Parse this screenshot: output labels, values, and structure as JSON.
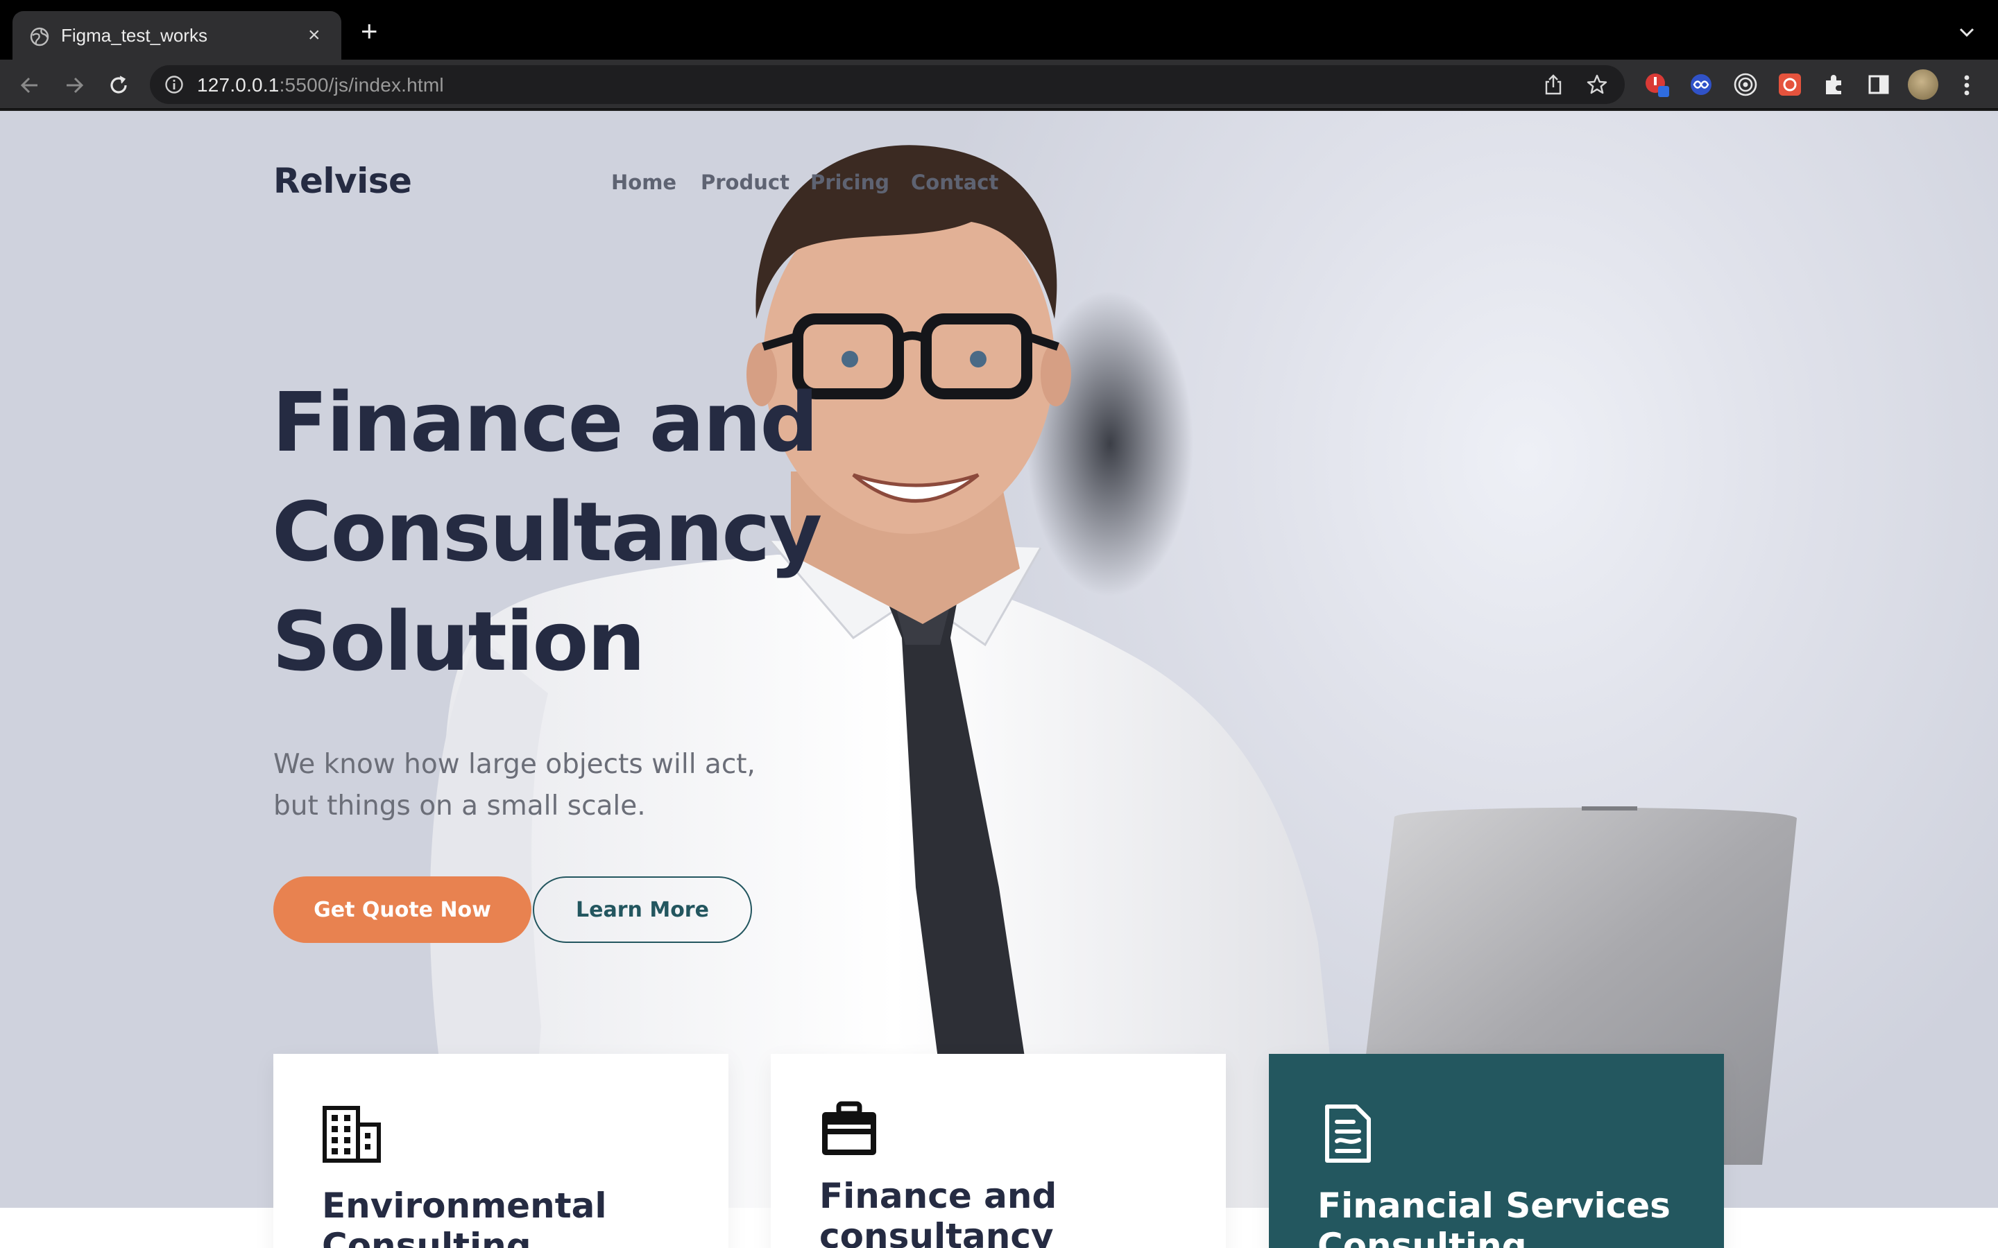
{
  "browser": {
    "tab_title": "Figma_test_works",
    "new_tab_label": "+",
    "close_tab_label": "×",
    "url_host": "127.0.0.1",
    "url_path": ":5500/js/index.html"
  },
  "site": {
    "logo": "Relvise",
    "nav": [
      "Home",
      "Product",
      "Pricing",
      "Contact"
    ],
    "hero": {
      "headline": [
        "Finance and",
        "Consultancy",
        "Solution"
      ],
      "subtitle": [
        "We know how large objects will act,",
        "but things on a small scale."
      ],
      "primary_cta": "Get Quote Now",
      "secondary_cta": "Learn More"
    },
    "services": [
      {
        "title_lines": [
          "Environmental",
          "Consulting"
        ],
        "icon": "building-icon"
      },
      {
        "title_lines": [
          "Finance and",
          "consultancy"
        ],
        "icon": "briefcase-icon"
      },
      {
        "title_lines": [
          "Financial Services",
          "Consulting"
        ],
        "icon": "document-icon"
      }
    ]
  },
  "colors": {
    "brand_dark": "#252b42",
    "accent_orange": "#e88250",
    "teal": "#23575f",
    "muted_text": "#6b6e78"
  }
}
